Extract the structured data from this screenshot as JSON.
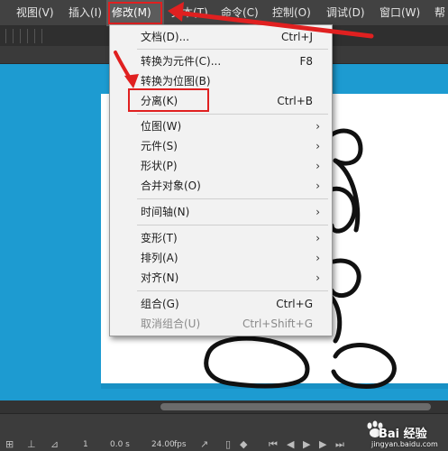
{
  "menubar": {
    "items": [
      "视图(V)",
      "插入(I)",
      "修改(M)",
      "文本(T)",
      "命令(C)",
      "控制(O)",
      "调试(D)",
      "窗口(W)",
      "帮"
    ]
  },
  "modify_menu": {
    "items": [
      {
        "label": "文档(D)...",
        "shortcut": "Ctrl+J",
        "submenu": false,
        "disabled": false
      },
      {
        "label": "转换为元件(C)...",
        "shortcut": "F8",
        "submenu": false,
        "disabled": false
      },
      {
        "label": "转换为位图(B)",
        "shortcut": "",
        "submenu": false,
        "disabled": false
      },
      {
        "label": "分离(K)",
        "shortcut": "Ctrl+B",
        "submenu": false,
        "disabled": false
      },
      {
        "label": "位图(W)",
        "shortcut": "",
        "submenu": true,
        "disabled": false
      },
      {
        "label": "元件(S)",
        "shortcut": "",
        "submenu": true,
        "disabled": false
      },
      {
        "label": "形状(P)",
        "shortcut": "",
        "submenu": true,
        "disabled": false
      },
      {
        "label": "合并对象(O)",
        "shortcut": "",
        "submenu": true,
        "disabled": false
      },
      {
        "label": "时间轴(N)",
        "shortcut": "",
        "submenu": true,
        "disabled": false
      },
      {
        "label": "变形(T)",
        "shortcut": "",
        "submenu": true,
        "disabled": false
      },
      {
        "label": "排列(A)",
        "shortcut": "",
        "submenu": true,
        "disabled": false
      },
      {
        "label": "对齐(N)",
        "shortcut": "",
        "submenu": true,
        "disabled": false
      },
      {
        "label": "组合(G)",
        "shortcut": "Ctrl+G",
        "submenu": false,
        "disabled": false
      },
      {
        "label": "取消组合(U)",
        "shortcut": "Ctrl+Shift+G",
        "submenu": false,
        "disabled": true
      }
    ]
  },
  "timeline": {
    "frame": "1",
    "time": "0.0 s",
    "fps_value": "24.00",
    "fps_unit": "fps"
  },
  "watermark": {
    "brand": "Bai 经验",
    "url": "jingyan.baidu.com"
  },
  "colors": {
    "stage_bg": "#1b9ad0",
    "highlight": "#e02020",
    "menu_bg": "#f2f2f2"
  }
}
